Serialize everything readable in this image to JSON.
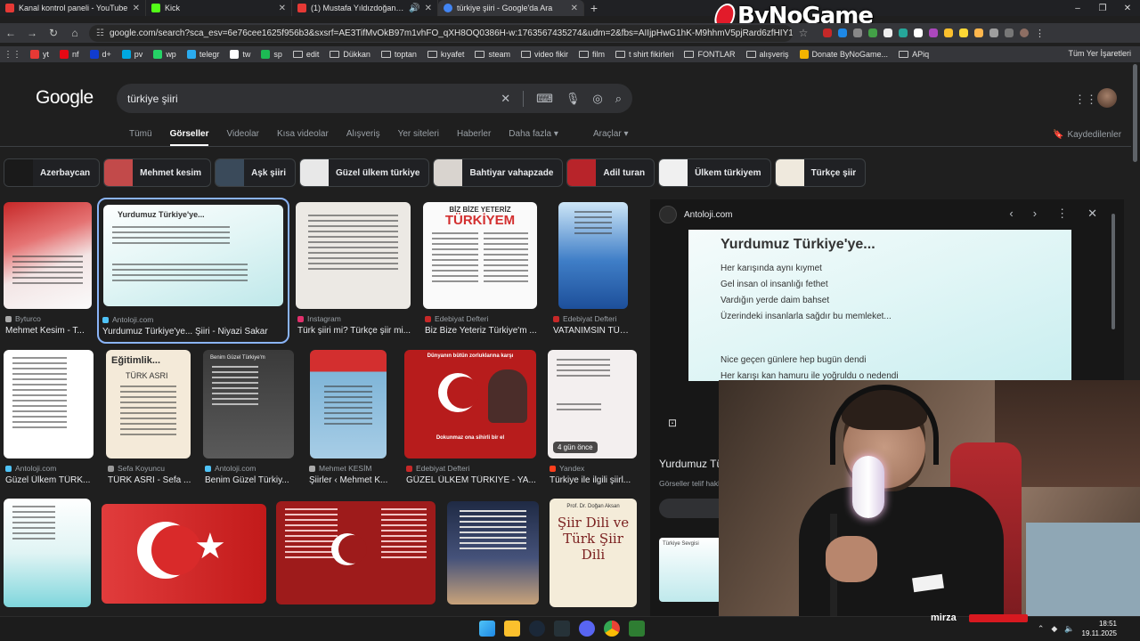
{
  "browser": {
    "tabs": [
      {
        "label": "Kanal kontrol paneli - YouTube",
        "color": "#e53935",
        "active": false
      },
      {
        "label": "Kick",
        "color": "#53fc18",
        "active": false
      },
      {
        "label": "(1) Mustafa Yıldızdoğan - Ö",
        "color": "#e53935",
        "active": false
      },
      {
        "label": "türkiye şiiri - Google'da Ara",
        "color": "#4285f4",
        "active": true
      }
    ],
    "new_tab": "+",
    "address": "google.com/search?sca_esv=6e76cee1625f956b3&sxsrf=AE3TifMvOkB97m1vhFO_qXH8OQ0386H-w:1763567435274&udm=2&fbs=AIIjpHwG1hK-M9hhmV5pjRard6zfHIY1XlCdN",
    "window_controls": [
      "–",
      "❐",
      "✕"
    ],
    "nav": {
      "back": "←",
      "forward": "→",
      "reload": "↻",
      "home": "⌂"
    },
    "bookmarks": [
      {
        "label": "yt",
        "color": "#e53935"
      },
      {
        "label": "nf",
        "color": "#e50914"
      },
      {
        "label": "d+",
        "color": "#113ccf"
      },
      {
        "label": "pv",
        "color": "#00a8e1"
      },
      {
        "label": "wp",
        "color": "#25d366"
      },
      {
        "label": "telegr",
        "color": "#2aabee"
      },
      {
        "label": "tw",
        "color": "#ffffff"
      },
      {
        "label": "sp",
        "color": "#1db954"
      },
      {
        "label": "edit",
        "color": "folder"
      },
      {
        "label": "Dükkan",
        "color": "folder"
      },
      {
        "label": "toptan",
        "color": "folder"
      },
      {
        "label": "kıyafet",
        "color": "folder"
      },
      {
        "label": "steam",
        "color": "folder"
      },
      {
        "label": "video fikir",
        "color": "folder"
      },
      {
        "label": "film",
        "color": "folder"
      },
      {
        "label": "t shirt fikirleri",
        "color": "folder"
      },
      {
        "label": "FONTLAR",
        "color": "folder"
      },
      {
        "label": "alışveriş",
        "color": "folder"
      },
      {
        "label": "Donate ByNoGame...",
        "color": "#f4b400"
      },
      {
        "label": "APiq",
        "color": "folder"
      }
    ],
    "all_bookmarks": "Tüm Yer İşaretleri"
  },
  "stream_logo": "ByNoGame",
  "google": {
    "logo": "Google",
    "query": "türkiye şiiri",
    "tabs": [
      "Tümü",
      "Görseller",
      "Videolar",
      "Kısa videolar",
      "Alışveriş",
      "Yer siteleri",
      "Haberler",
      "Daha fazla ▾"
    ],
    "active_tab": "Görseller",
    "tools": "Araçlar ▾",
    "saved": "Kaydedilenler",
    "chips": [
      {
        "label": "Azerbaycan",
        "color": "#1a1a1a"
      },
      {
        "label": "Mehmet kesim",
        "color": "#c24a4a"
      },
      {
        "label": "Aşk şiiri",
        "color": "#3a4a5a"
      },
      {
        "label": "Güzel ülkem türkiye",
        "color": "#e8e8e8"
      },
      {
        "label": "Bahtiyar vahapzade",
        "color": "#d9d4cf"
      },
      {
        "label": "Adil turan",
        "color": "#b8242a"
      },
      {
        "label": "Ülkem türkiyem",
        "color": "#f0f0f0"
      },
      {
        "label": "Türkçe şiir",
        "color": "#efe9dd"
      }
    ]
  },
  "results": [
    {
      "source": "Byturco",
      "title": "Mehmet Kesim - T...",
      "src_color": "#aaa"
    },
    {
      "source": "Antoloji.com",
      "title": "Yurdumuz Türkiye'ye... Şiiri - Niyazi Sakar",
      "src_color": "#4fc3f7"
    },
    {
      "source": "Instagram",
      "title": "Türk şiiri mi? Türkçe şiir mi...",
      "src_color": "#e1306c"
    },
    {
      "source": "Edebiyat Defteri",
      "title": "Biz Bize Yeteriz Türkiye'm ...",
      "src_color": "#c62828"
    },
    {
      "source": "Edebiyat Defteri",
      "title": "VATANIMSIN TÜR...",
      "src_color": "#c62828"
    },
    {
      "source": "Antoloji.com",
      "title": "Güzel Ülkem TÜRK...",
      "src_color": "#4fc3f7"
    },
    {
      "source": "Sefa Koyuncu",
      "title": "TÜRK ASRI - Sefa ...",
      "src_color": "#999"
    },
    {
      "source": "Antoloji.com",
      "title": "Benim Güzel Türkiy...",
      "src_color": "#4fc3f7"
    },
    {
      "source": "Mehmet KESİM",
      "title": "Şiirler ‹ Mehmet K...",
      "src_color": "#aaa"
    },
    {
      "source": "Edebiyat Defteri",
      "title": "GÜZEL ÜLKEM TÜRKİYE - YA...",
      "src_color": "#c62828"
    },
    {
      "source": "Yandex",
      "title": "Türkiye ile ilgili şiirl...",
      "src_color": "#fc3f1d"
    }
  ],
  "thumb_text": {
    "biz_bize": "BİZ BİZE YETERİZ",
    "turkiyem": "TÜRKİYEM",
    "egitim": "Eğitimlik...",
    "turk_asri": "TÜRK ASRI",
    "benim_guzel": "Benim Güzel Türkiye'm",
    "ataturk_line1": "Dünyanın bütün zorluklarına karşı",
    "ataturk_line2": "Dokunmaz ona sihirli bir el",
    "siir_dili_author": "Prof. Dr. Doğan Aksan",
    "siir_dili_title": "Şiir Dili ve Türk Şiir Dili",
    "four_days": "4 gün önce"
  },
  "preview": {
    "site": "Antoloji.com",
    "poem_title": "Yurdumuz Türkiye'ye...",
    "lines": [
      "Her karışında aynı kıymet",
      "Gel insan ol insanlığı fethet",
      "Vardığın yerde daim bahset",
      "Üzerindeki insanlarla sağdır bu memleket...",
      "",
      "Nice geçen günlere hep bugün dendi",
      "Her karışı kan hamuru ile yoğruldu o nedendi"
    ],
    "title_cut": "Yurdumuz Tü",
    "sub_cut": "Görseller telif hakk",
    "related": "Türkiye Sevgisi"
  },
  "stream": {
    "name": "mirza",
    "time": "18:51",
    "date": "19.11.2025"
  }
}
